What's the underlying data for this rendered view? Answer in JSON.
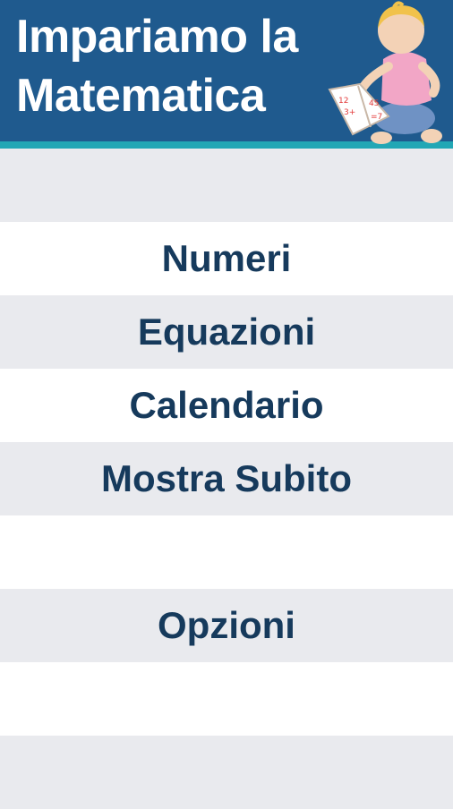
{
  "header": {
    "title_line1": "Impariamo la",
    "title_line2": "Matematica",
    "bg_color": "#1f5a8e",
    "accent_color": "#22a7b5"
  },
  "menu": {
    "items": [
      {
        "label": ""
      },
      {
        "label": "Numeri"
      },
      {
        "label": "Equazioni"
      },
      {
        "label": "Calendario"
      },
      {
        "label": "Mostra Subito"
      },
      {
        "label": ""
      },
      {
        "label": "Opzioni"
      },
      {
        "label": ""
      },
      {
        "label": ""
      }
    ],
    "text_color": "#163a5c"
  }
}
